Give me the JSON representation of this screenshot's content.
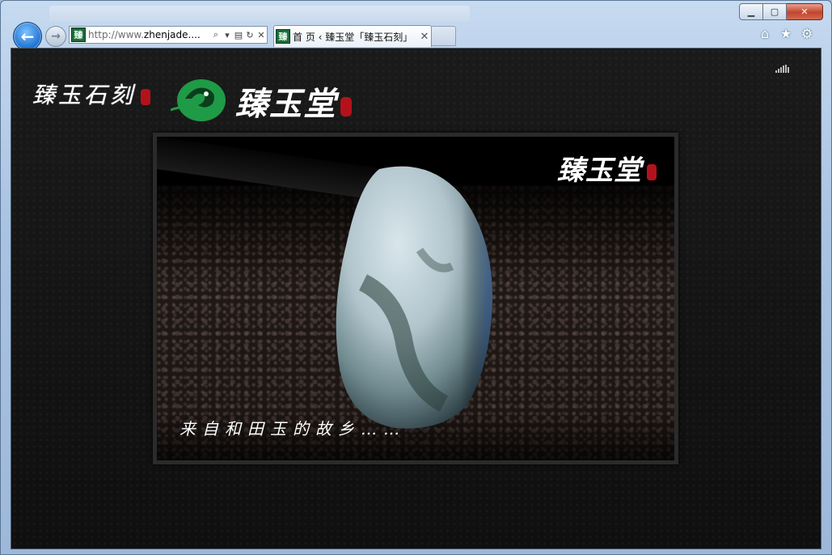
{
  "browser": {
    "address": "http://www.zhenjade....",
    "address_prefix": "http://www.",
    "address_host": "zhenjade....",
    "favicon_char": "臻",
    "tab_title": "首 页 ‹ 臻玉堂「臻玉石刻」",
    "icons": {
      "back": "back-arrow-icon",
      "forward": "forward-arrow-icon",
      "search": "search-icon",
      "dropdown": "chevron-down-icon",
      "compat": "compatibility-view-icon",
      "refresh": "refresh-icon",
      "stop": "stop-icon",
      "home": "home-icon",
      "favorites": "star-icon",
      "tools": "gear-icon"
    }
  },
  "page": {
    "logo_left": "臻玉石刻",
    "logo_main": "臻玉堂",
    "banner_title": "臻玉堂",
    "banner_slogan": "来自和田玉的故乡……",
    "colors": {
      "brand_green": "#1f9a46",
      "seal_red": "#b4121b",
      "background": "#141414"
    }
  }
}
